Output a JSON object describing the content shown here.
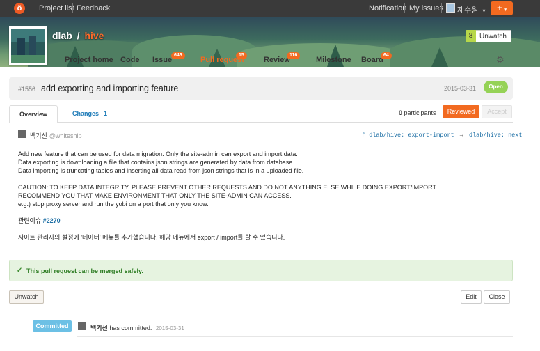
{
  "topnav": {
    "logo_glyph": "ö",
    "project_list": "Project list",
    "feedback": "Feedback",
    "notification": "Notification",
    "my_issues": "My issues",
    "user_name": "제수원",
    "user_caret": "▾",
    "plus_label": "+",
    "plus_caret": "▾"
  },
  "project": {
    "owner": "dlab",
    "separator": "/",
    "repo": "hive",
    "watch_count": "8",
    "watch_label": "Unwatch",
    "watch_caret": "▾"
  },
  "tabs": [
    {
      "label": "Project home",
      "badge": ""
    },
    {
      "label": "Code",
      "badge": ""
    },
    {
      "label": "Issue",
      "badge": "646"
    },
    {
      "label": "Pull request",
      "badge": "15",
      "active": true
    },
    {
      "label": "Review",
      "badge": "116"
    },
    {
      "label": "Milestone",
      "badge": ""
    },
    {
      "label": "Board",
      "badge": "64"
    }
  ],
  "settings_icon": "⚙",
  "pr": {
    "number": "#1556",
    "title": "add exporting and importing feature",
    "date": "2015-03-31",
    "status": "Open"
  },
  "subtabs": {
    "overview": "Overview",
    "changes": "Changes",
    "changes_count": "1"
  },
  "participants": {
    "count": "0",
    "label": "participants"
  },
  "buttons": {
    "reviewed": "Reviewed",
    "accept": "Accept",
    "unwatch": "Unwatch",
    "edit": "Edit",
    "close": "Close"
  },
  "author": {
    "name": "백기선",
    "id": "@whiteship",
    "branch_icon": "ᚠ",
    "from_branch": "dlab/hive: export-import",
    "arrow": "→",
    "to_branch": "dlab/hive: next"
  },
  "body": {
    "para1_l1": "Add new feature that can be used for data migration. Only the site-admin can export and import data.",
    "para1_l2": "Data exporting is downloading a file that contains json strings are generated by data from database.",
    "para1_l3": "Data importing is truncating tables and inserting all data read from json strings that is in a uploaded file.",
    "para2_l1": "CAUTION: TO KEEP DATA INTEGRITY, PLEASE PREVENT OTHER REQUESTS AND DO NOT ANYTHING ELSE WHILE DOING EXPORT/IMPORT",
    "para2_l2": "RECOMMEND YOU THAT MAKE ENVIRONMENT THAT ONLY THE SITE-ADMIN CAN ACCESS.",
    "para2_l3": "e.g.) stop proxy server and run the yobi on a port that only you know.",
    "related_label": "관련이슈",
    "related_link": "#2270",
    "korean": "사이트 관리자의 설정에 '데이터' 메뉴를 추가했습니다. 해당 메뉴에서 export / import를 할 수 있습니다."
  },
  "merge": {
    "icon": "✓",
    "text": "This pull request can be merged safely."
  },
  "timeline": {
    "badge": "Committed",
    "author": "백기선",
    "action": "has committed.",
    "date": "2015-03-31"
  }
}
